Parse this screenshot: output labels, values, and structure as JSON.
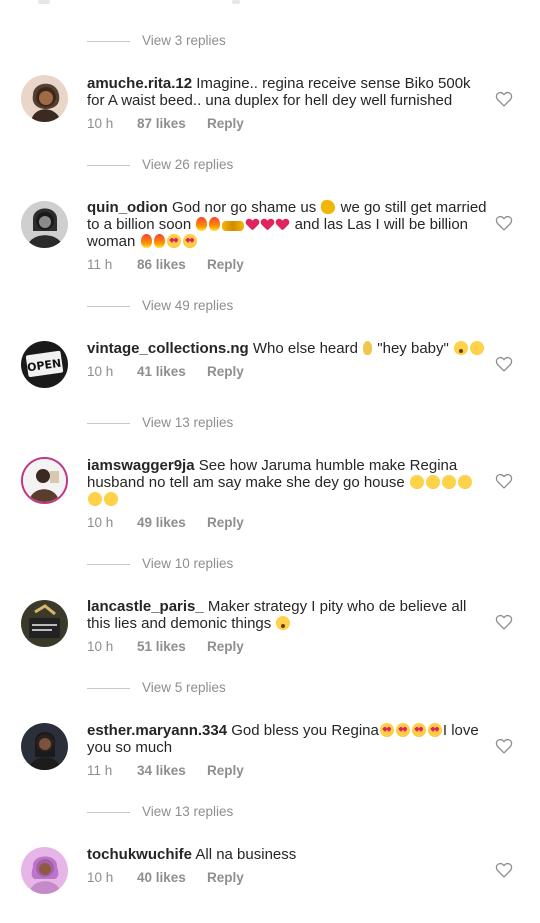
{
  "colors": {
    "text": "#262626",
    "meta": "#8e8e8e",
    "background": "#ffffff"
  },
  "top_view_replies": {
    "label": "View 3 replies"
  },
  "comments": [
    {
      "username": "amuche.rita.12",
      "text_parts": [
        "Imagine.. regina receive sense Biko 500k for A waist beed.. una duplex for hell dey well furnished"
      ],
      "time": "10 h",
      "likes": "87 likes",
      "reply": "Reply",
      "view_replies": "View 26 replies"
    },
    {
      "username": "quin_odion",
      "text_parts": [
        "God nor go shame us",
        "we go still get married to a billion soon",
        "and las Las I will be billion woman"
      ],
      "time": "11 h",
      "likes": "86 likes",
      "reply": "Reply",
      "view_replies": "View 49 replies"
    },
    {
      "username": "vintage_collections.ng",
      "text_parts": [
        "Who else heard",
        "\"hey baby\""
      ],
      "time": "10 h",
      "likes": "41 likes",
      "reply": "Reply",
      "view_replies": "View 13 replies",
      "avatar_text": "OPEN"
    },
    {
      "username": "iamswagger9ja",
      "text_parts": [
        "See how Jaruma humble make Regina husband no tell am say make she dey go house"
      ],
      "time": "10 h",
      "likes": "49 likes",
      "reply": "Reply",
      "view_replies": "View 10 replies"
    },
    {
      "username": "lancastle_paris_",
      "text_parts": [
        "Maker strategy I pity who de believe all this lies and demonic things"
      ],
      "time": "10 h",
      "likes": "51 likes",
      "reply": "Reply",
      "view_replies": "View 5 replies"
    },
    {
      "username": "esther.maryann.334",
      "text_parts": [
        "God bless you Regina",
        "I love you so much"
      ],
      "time": "11 h",
      "likes": "34 likes",
      "reply": "Reply",
      "view_replies": "View 13 replies"
    },
    {
      "username": "tochukwuchife",
      "text_parts": [
        "All na business"
      ],
      "time": "10 h",
      "likes": "40 likes",
      "reply": "Reply"
    }
  ]
}
